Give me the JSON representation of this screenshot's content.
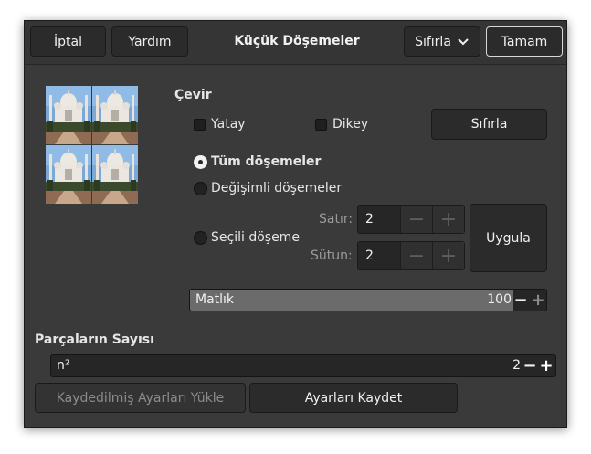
{
  "header": {
    "cancel_label": "İptal",
    "help_label": "Yardım",
    "title": "Küçük Döşemeler",
    "reset_menu_label": "Sıfırla",
    "ok_label": "Tamam"
  },
  "flip": {
    "heading": "Çevir",
    "horizontal_label": "Yatay",
    "vertical_label": "Dikey",
    "reset_label": "Sıfırla"
  },
  "tiles": {
    "all_label": "Tüm döşemeler",
    "alternate_label": "Değişimli döşemeler",
    "selected_label": "Seçili döşeme",
    "selected_mode": "all"
  },
  "position": {
    "row_label": "Satır:",
    "row_value": "2",
    "column_label": "Sütun:",
    "column_value": "2",
    "apply_label": "Uygula"
  },
  "opacity": {
    "label": "Matlık",
    "value": "100",
    "fraction": 1.0
  },
  "segments": {
    "heading": "Parçaların Sayısı",
    "field_label": "n²",
    "value": "2"
  },
  "footer": {
    "load_label": "Kaydedilmiş Ayarları Yükle",
    "save_label": "Ayarları Kaydet"
  },
  "colors": {
    "dialog_bg": "#3a3a3a",
    "button_bg": "#2b2b2b"
  }
}
